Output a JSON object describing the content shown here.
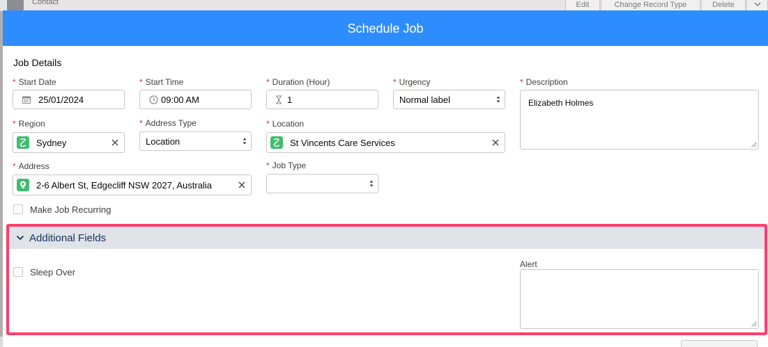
{
  "background": {
    "object_label": "Contact",
    "buttons": [
      "Edit",
      "Change Record Type",
      "Delete"
    ]
  },
  "modal": {
    "title": "Schedule Job",
    "section_title": "Job Details",
    "fields": {
      "start_date": {
        "label": "Start Date",
        "value": "25/01/2024"
      },
      "start_time": {
        "label": "Start Time",
        "value": "09:00 AM"
      },
      "duration": {
        "label": "Duration (Hour)",
        "value": "1"
      },
      "urgency": {
        "label": "Urgency",
        "value": "Normal label"
      },
      "description": {
        "label": "Description",
        "value": "Elizabeth Holmes"
      },
      "region": {
        "label": "Region",
        "value": "Sydney"
      },
      "address_type": {
        "label": "Address Type",
        "value": "Location"
      },
      "location": {
        "label": "Location",
        "value": "St Vincents Care Services"
      },
      "address": {
        "label": "Address",
        "value": "2-6 Albert St, Edgecliff NSW 2027, Australia"
      },
      "job_type": {
        "label": "Job Type",
        "value": ""
      },
      "recurring": {
        "label": "Make Job Recurring",
        "checked": false
      }
    },
    "additional": {
      "title": "Additional Fields",
      "sleep_over": {
        "label": "Sleep Over",
        "checked": false
      },
      "alert": {
        "label": "Alert",
        "value": ""
      }
    }
  },
  "colors": {
    "header": "#2d8dff",
    "highlight": "#ff3d6c",
    "pill_icon": "#3fbe6f",
    "required": "#c23934"
  },
  "icons": {
    "date": "calendar-icon",
    "time": "clock-icon",
    "duration": "hourglass-icon",
    "lookup": "record-icon",
    "address": "map-pin-icon",
    "clear": "close-icon",
    "section": "chevron-down-icon"
  }
}
